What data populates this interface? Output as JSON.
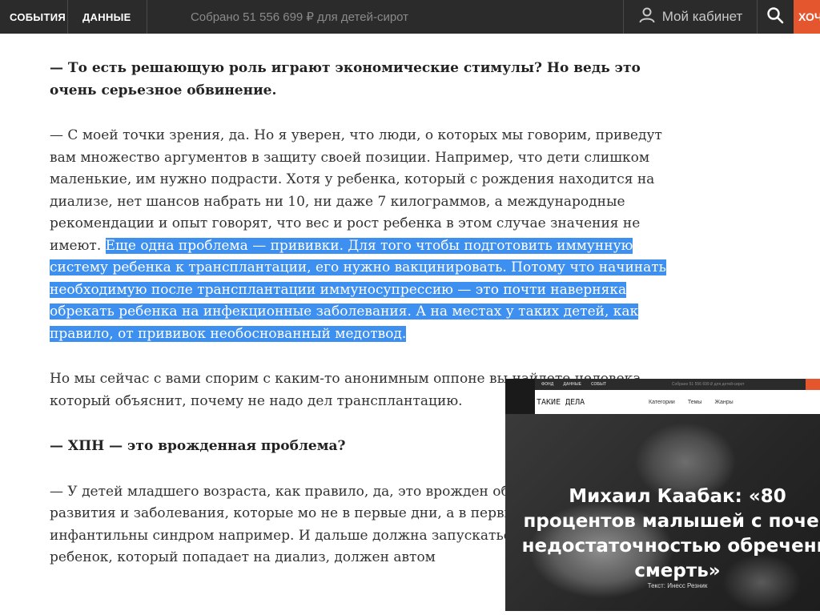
{
  "topbar": {
    "nav": [
      "СОБЫТИЯ",
      "ДАННЫЕ"
    ],
    "collected_text": "Собрано 51 556 699 ₽ для детей-сирот",
    "cabinet_label": "Мой кабинет",
    "help_label": "ХОЧУ ПОМОЧЬ",
    "accent_color": "#e4572e",
    "icons": [
      "user-icon",
      "search-icon"
    ]
  },
  "article": {
    "q1": "— То есть решающую роль играют экономические стимулы? Но ведь это очень серьезное обвинение.",
    "a1_plain": "— С моей точки зрения, да. Но я уверен, что люди, о которых мы говорим, приведут вам множество аргументов в защиту своей позиции. Например, что дети слишком маленькие, им нужно подрасти. Хотя у ребенка, который с рождения находится на диализе, нет шансов набрать ни 10, ни даже 7 килограммов, а международные рекомендации и опыт говорят, что вес и рост ребенка в этом случае значения не имеют.",
    "a1_selected": "Еще одна проблема — прививки. Для того чтобы подготовить иммунную систему ребенка к трансплантации, его нужно вакцинировать. Потому что начинать необходимую после трансплантации иммуносупрессию — это почти наверняка обрекать ребенка на инфекционные заболевания. А на местах у таких детей, как правило, от прививок необоснованный медотвод.",
    "a2": "Но мы сейчас с вами спорим с каким-то анонимным оппоне вы найдете человека, который объяснит, почему не надо дел трансплантацию.",
    "q2": "— ХПН — это врожденная проблема?",
    "a3": "— У детей младшего возраста, как правило, да, это врожден обусловленные пороки развития и заболевания, которые мо не в первые дни, а в первые месяцы жизни, как инфантильны синдром например. И дальше должна запускаться машина с Всякий ребенок, который попадает на диализ, должен автом",
    "selection_color": "#3d8ff0"
  },
  "video": {
    "mini_nav": [
      "ФОНД",
      "ДАННЫЕ",
      "СОБЫТ"
    ],
    "mini_collected": "Собрано 51 556 699 ₽ для детей-сирот",
    "logo": "ТАКИЕ ДЕЛА",
    "menu": [
      "Категории",
      "Темы",
      "Жанры"
    ],
    "title_lines": [
      "Михаил Каабак: «80",
      "процентов малышей с почеч",
      "недостаточностью обречены",
      "смерть»"
    ],
    "author": "Текст: Инесс Резник"
  }
}
